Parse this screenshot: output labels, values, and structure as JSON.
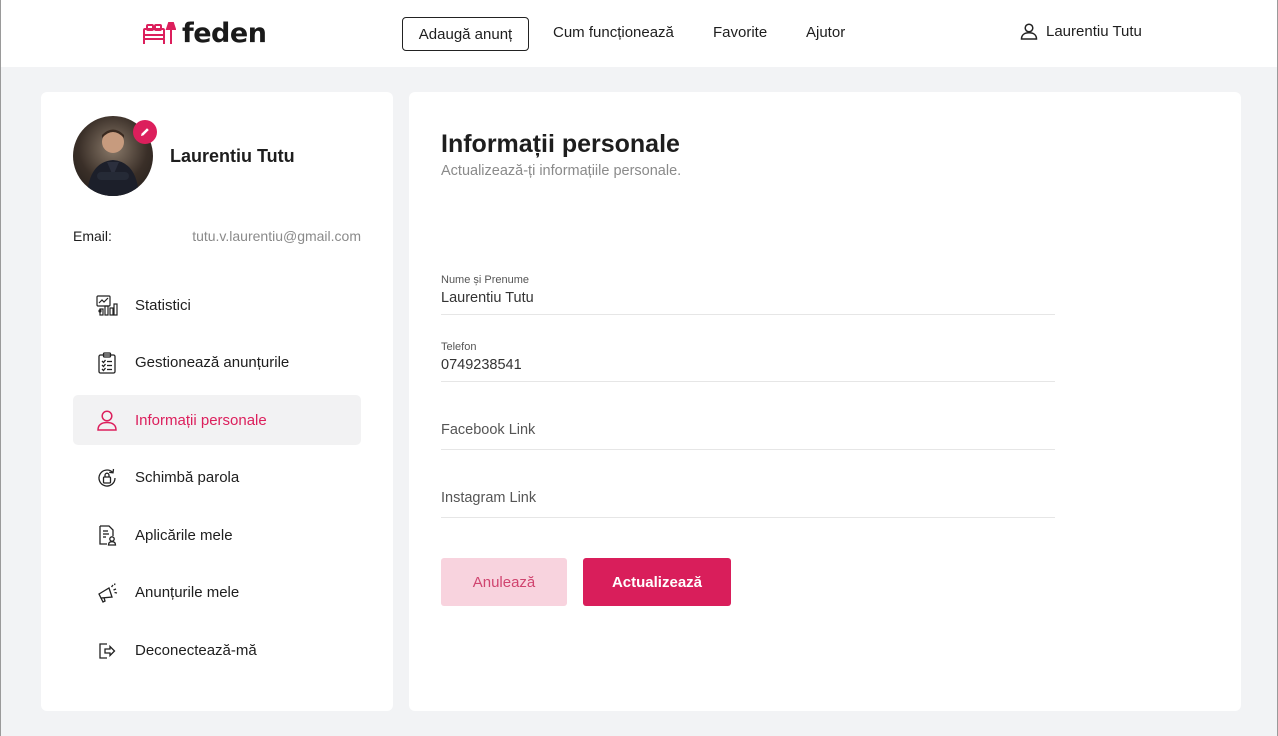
{
  "header": {
    "logo_text": "feden",
    "add_listing_label": "Adaugă anunț",
    "nav": [
      "Cum funcționează",
      "Favorite",
      "Ajutor"
    ],
    "user_name": "Laurentiu Tutu"
  },
  "sidebar": {
    "profile_name": "Laurentiu Tutu",
    "email_label": "Email:",
    "email_value": "tutu.v.laurentiu@gmail.com",
    "items": [
      {
        "label": "Statistici",
        "icon": "statistics-icon",
        "active": false
      },
      {
        "label": "Gestionează anunțurile",
        "icon": "clipboard-checklist-icon",
        "active": false
      },
      {
        "label": "Informații personale",
        "icon": "user-icon",
        "active": true
      },
      {
        "label": "Schimbă parola",
        "icon": "lock-refresh-icon",
        "active": false
      },
      {
        "label": "Aplicările mele",
        "icon": "document-user-icon",
        "active": false
      },
      {
        "label": "Anunțurile mele",
        "icon": "megaphone-icon",
        "active": false
      },
      {
        "label": "Deconectează-mă",
        "icon": "logout-icon",
        "active": false
      }
    ]
  },
  "main": {
    "title": "Informații personale",
    "subtitle": "Actualizează-ți informațiile personale.",
    "fields": [
      {
        "label": "Nume și Prenume",
        "value": "Laurentiu Tutu",
        "placeholder": ""
      },
      {
        "label": "Telefon",
        "value": "0749238541",
        "placeholder": ""
      },
      {
        "label": "",
        "value": "",
        "placeholder": "Facebook Link"
      },
      {
        "label": "",
        "value": "",
        "placeholder": "Instagram Link"
      }
    ],
    "cancel_label": "Anulează",
    "update_label": "Actualizează"
  },
  "colors": {
    "accent": "#dc1f5c",
    "accent_light": "#f8d3de",
    "background": "#f2f3f5",
    "active_item_bg": "#f2f2f3"
  }
}
